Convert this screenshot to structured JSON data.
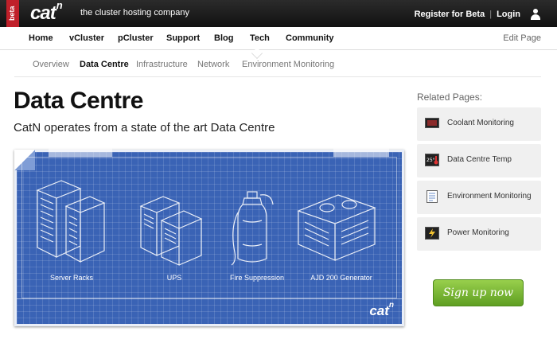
{
  "brand": {
    "badge": "beta",
    "logo": "cat",
    "logo_sup": "n",
    "tagline": "the cluster hosting company"
  },
  "account": {
    "register": "Register for Beta",
    "separator": "|",
    "login": "Login",
    "icon": "user-icon"
  },
  "main_nav": [
    {
      "label": "Home"
    },
    {
      "label": "vCluster"
    },
    {
      "label": "pCluster"
    },
    {
      "label": "Support"
    },
    {
      "label": "Blog"
    },
    {
      "label": "Tech"
    },
    {
      "label": "Community"
    }
  ],
  "edit_page": "Edit Page",
  "sub_nav": [
    {
      "label": "Overview",
      "active": false
    },
    {
      "label": "Data Centre",
      "active": true
    },
    {
      "label": "Infrastructure",
      "active": false
    },
    {
      "label": "Network",
      "active": false
    },
    {
      "label": "Environment Monitoring",
      "active": false
    }
  ],
  "page": {
    "title": "Data Centre",
    "subtitle": "CatN operates from a state of the art Data Centre"
  },
  "blueprint": {
    "items": [
      "Server Racks",
      "UPS",
      "Fire Suppression",
      "AJD 200 Generator"
    ],
    "logo": "cat",
    "logo_sup": "n"
  },
  "related": {
    "title": "Related Pages:",
    "items": [
      {
        "label": "Coolant Monitoring",
        "icon": "monitor-icon"
      },
      {
        "label": "Data Centre Temp",
        "icon": "thermometer-icon"
      },
      {
        "label": "Environment Monitoring",
        "icon": "document-icon"
      },
      {
        "label": "Power Monitoring",
        "icon": "power-icon"
      }
    ]
  },
  "cta": {
    "label": "Sign up now"
  },
  "colors": {
    "blueprint": "#3a63b5",
    "cta": "#6fae2c",
    "topbar": "#1a1a1a",
    "badge": "#c0202a"
  }
}
